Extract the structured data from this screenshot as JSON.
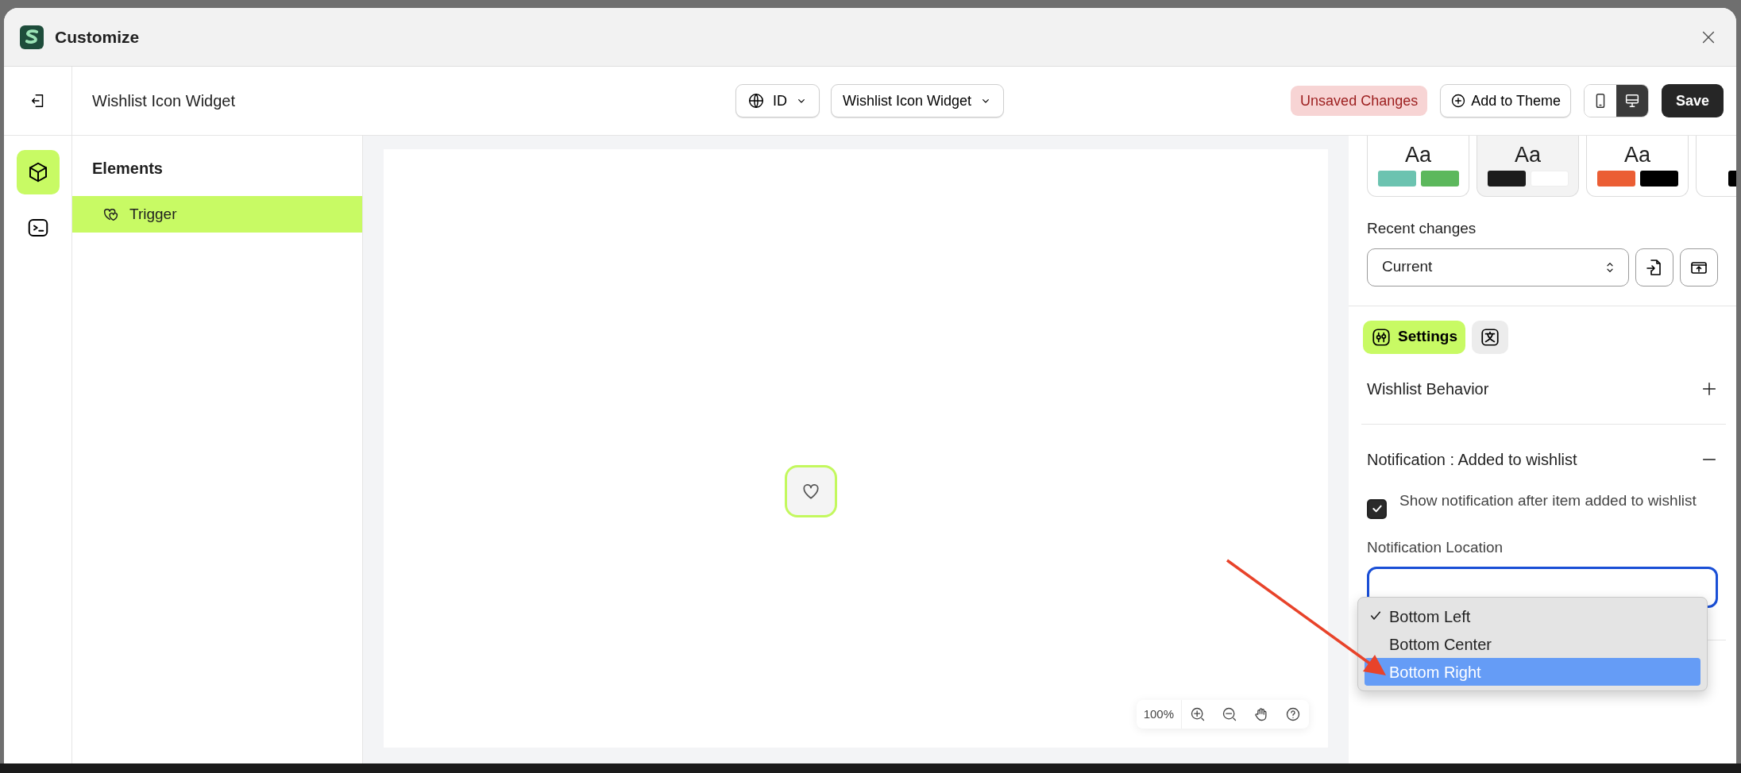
{
  "window": {
    "title": "Customize"
  },
  "rail": [
    {
      "kind": "cube",
      "selected": true
    },
    {
      "kind": "terminal",
      "selected": false
    }
  ],
  "header": {
    "title": "Wishlist Icon Widget",
    "language": "ID",
    "widget_select": "Wishlist Icon Widget",
    "status_badge": "Unsaved Changes",
    "add_button": "Add to Theme",
    "devices": [
      {
        "kind": "mobile",
        "selected": false
      },
      {
        "kind": "desktop",
        "selected": true
      }
    ],
    "save_button": "Save"
  },
  "elements": {
    "title": "Elements",
    "items": [
      {
        "label": "Trigger",
        "selected": true
      }
    ]
  },
  "canvas": {
    "zoom": "100%"
  },
  "themes": [
    {
      "label": "Aa",
      "swatches": [
        {
          "color": "#6cc3b0"
        },
        {
          "color": "#5cb85c"
        }
      ],
      "selected": false
    },
    {
      "label": "Aa",
      "swatches": [
        {
          "color": "#1c1c1c"
        },
        {
          "color": "#ffffff"
        }
      ],
      "selected": true
    },
    {
      "label": "Aa",
      "swatches": [
        {
          "color": "#eb5e34"
        },
        {
          "color": "#000000"
        }
      ],
      "selected": false
    },
    {
      "swatches": [
        {
          "color": "#000000"
        }
      ],
      "selected": false
    }
  ],
  "recent_changes": {
    "label": "Recent changes",
    "value": "Current"
  },
  "panel_tabs": [
    {
      "kind": "settings",
      "label": "Settings",
      "selected": true
    },
    {
      "kind": "translate",
      "selected": false
    }
  ],
  "sections": [
    {
      "title": "Wishlist Behavior",
      "expanded": false
    },
    {
      "title": "Notification : Added to wishlist",
      "expanded": true,
      "checkbox": {
        "label": "Show notification after item added to wishlist",
        "checked": true
      },
      "select": {
        "label": "Notification Location",
        "options": [
          {
            "label": "Bottom Left",
            "selected": true,
            "highlighted": false
          },
          {
            "label": "Bottom Center",
            "selected": false,
            "highlighted": false
          },
          {
            "label": "Bottom Right",
            "selected": false,
            "highlighted": true
          }
        ]
      }
    }
  ]
}
